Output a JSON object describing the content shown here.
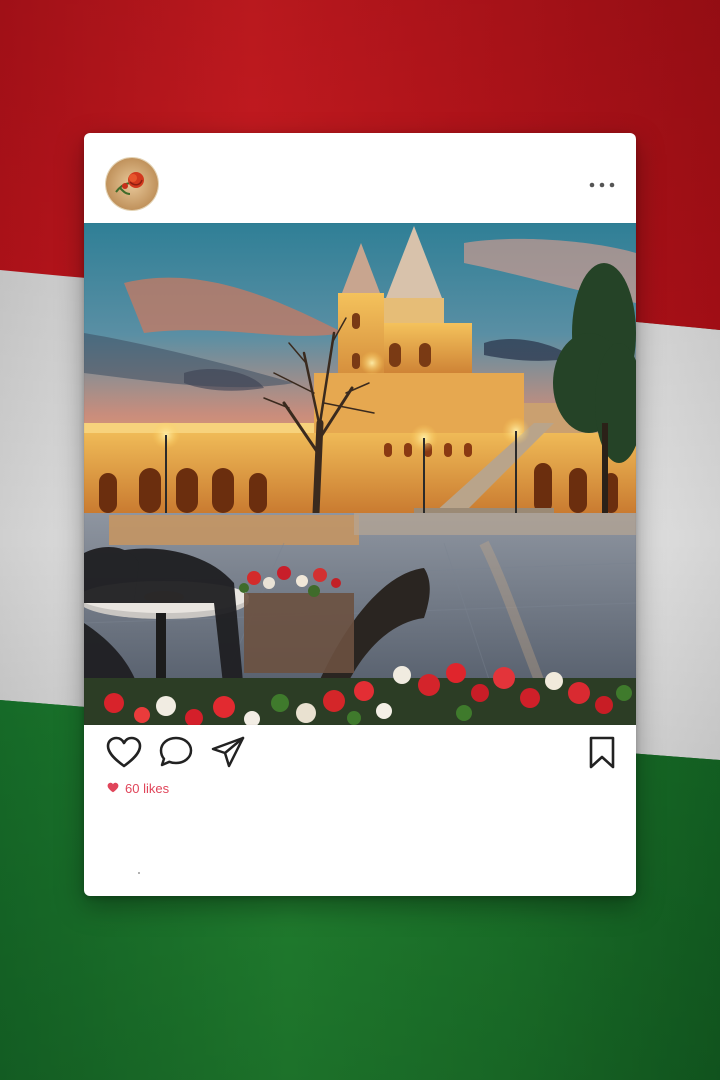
{
  "post": {
    "avatar_icon": "rose-avatar-icon",
    "more_icon": "more-options-icon",
    "photo_description_icon": "fishermans-bastion-photo",
    "actions": {
      "like_icon": "heart-outline-icon",
      "comment_icon": "comment-bubble-icon",
      "share_icon": "paper-plane-icon",
      "save_icon": "bookmark-icon"
    },
    "likes": {
      "icon": "heart-filled-icon",
      "text": "60 likes"
    }
  },
  "background": {
    "icon": "hungarian-flag-icon",
    "colors": {
      "red": "#c8171e",
      "white": "#e8e8e8",
      "green": "#1f7a2a"
    }
  },
  "colors": {
    "like_red": "#e0455a",
    "icon_dark": "#222222"
  }
}
